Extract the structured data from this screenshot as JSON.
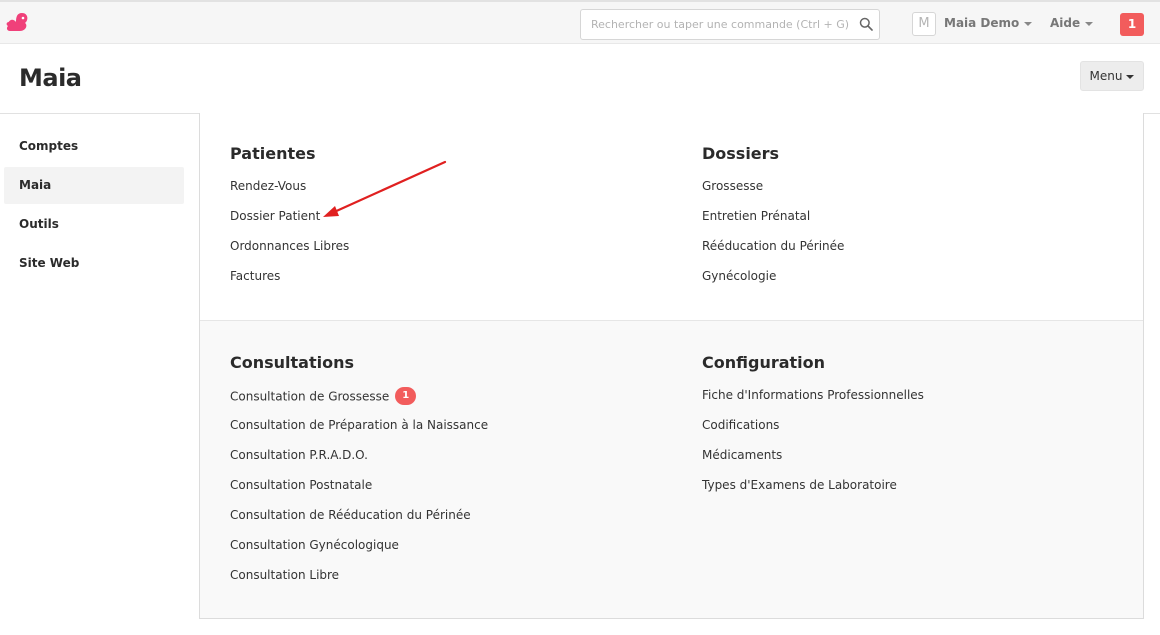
{
  "topbar": {
    "logo_icon": "squirrel-icon",
    "search_placeholder": "Rechercher ou taper une commande (Ctrl + G)",
    "avatar_letter": "M",
    "user_name": "Maia Demo",
    "help_label": "Aide",
    "notification_count": "1"
  },
  "page": {
    "title": "Maia",
    "menu_label": "Menu"
  },
  "sidebar": {
    "items": [
      {
        "label": "Comptes",
        "active": false
      },
      {
        "label": "Maia",
        "active": true
      },
      {
        "label": "Outils",
        "active": false
      },
      {
        "label": "Site Web",
        "active": false
      }
    ]
  },
  "sections": {
    "patientes": {
      "title": "Patientes",
      "links": [
        "Rendez-Vous",
        "Dossier Patient",
        "Ordonnances Libres",
        "Factures"
      ]
    },
    "dossiers": {
      "title": "Dossiers",
      "links": [
        "Grossesse",
        "Entretien Prénatal",
        "Rééducation du Périnée",
        "Gynécologie"
      ]
    },
    "consultations": {
      "title": "Consultations",
      "links": [
        "Consultation de Grossesse",
        "Consultation de Préparation à la Naissance",
        "Consultation P.R.A.D.O.",
        "Consultation Postnatale",
        "Consultation de Rééducation du Périnée",
        "Consultation Gynécologique",
        "Consultation Libre"
      ],
      "grossesse_badge": "1"
    },
    "configuration": {
      "title": "Configuration",
      "links": [
        "Fiche d'Informations Professionnelles",
        "Codifications",
        "Médicaments",
        "Types d'Examens de Laboratoire"
      ]
    }
  },
  "colors": {
    "accent": "#f25c5c",
    "annotation_arrow": "#e02020",
    "logo": "#f0407a"
  }
}
